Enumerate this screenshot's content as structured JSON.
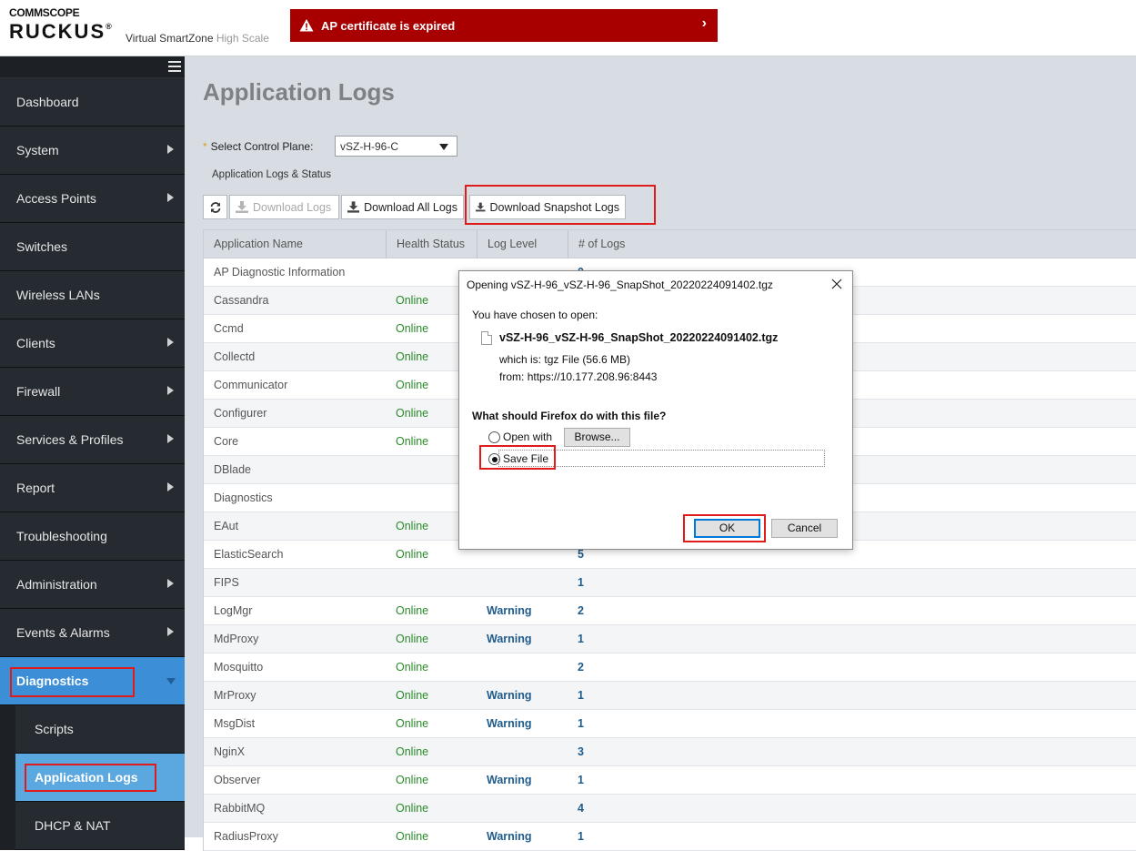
{
  "header": {
    "brand_top": "COMMSCOPE",
    "brand_main": "RUCKUS",
    "product_name": "Virtual SmartZone",
    "product_edition": "High Scale",
    "alert_text": "AP certificate is expired",
    "alert_color": "#a80000"
  },
  "sidebar": {
    "items": [
      {
        "label": "Dashboard",
        "has_arrow": false
      },
      {
        "label": "System",
        "has_arrow": true
      },
      {
        "label": "Access Points",
        "has_arrow": true
      },
      {
        "label": "Switches",
        "has_arrow": false
      },
      {
        "label": "Wireless LANs",
        "has_arrow": false
      },
      {
        "label": "Clients",
        "has_arrow": true
      },
      {
        "label": "Firewall",
        "has_arrow": true
      },
      {
        "label": "Services & Profiles",
        "has_arrow": true
      },
      {
        "label": "Report",
        "has_arrow": true
      },
      {
        "label": "Troubleshooting",
        "has_arrow": false
      },
      {
        "label": "Administration",
        "has_arrow": true
      },
      {
        "label": "Events & Alarms",
        "has_arrow": true
      },
      {
        "label": "Diagnostics",
        "active": true
      }
    ],
    "sub_items": [
      {
        "label": "Scripts",
        "active": false
      },
      {
        "label": "Application Logs",
        "active": true
      },
      {
        "label": "DHCP & NAT",
        "active": false
      }
    ]
  },
  "page": {
    "title": "Application Logs",
    "control_plane_label": "Select Control Plane:",
    "control_plane_value": "vSZ-H-96-C",
    "section_label": "Application Logs & Status"
  },
  "toolbar": {
    "download_logs": "Download Logs",
    "download_all_logs": "Download All Logs",
    "download_snapshot_logs": "Download Snapshot Logs"
  },
  "table": {
    "columns": [
      "Application Name",
      "Health Status",
      "Log Level",
      "# of Logs"
    ],
    "rows": [
      [
        "AP Diagnostic Information",
        "",
        "",
        "0"
      ],
      [
        "Cassandra",
        "Online",
        "",
        ""
      ],
      [
        "Ccmd",
        "Online",
        "",
        ""
      ],
      [
        "Collectd",
        "Online",
        "",
        ""
      ],
      [
        "Communicator",
        "Online",
        "",
        ""
      ],
      [
        "Configurer",
        "Online",
        "",
        ""
      ],
      [
        "Core",
        "Online",
        "",
        ""
      ],
      [
        "DBlade",
        "",
        "",
        ""
      ],
      [
        "Diagnostics",
        "",
        "",
        ""
      ],
      [
        "EAut",
        "Online",
        "",
        ""
      ],
      [
        "ElasticSearch",
        "Online",
        "",
        "5"
      ],
      [
        "FIPS",
        "",
        "",
        "1"
      ],
      [
        "LogMgr",
        "Online",
        "Warning",
        "2"
      ],
      [
        "MdProxy",
        "Online",
        "Warning",
        "1"
      ],
      [
        "Mosquitto",
        "Online",
        "",
        "2"
      ],
      [
        "MrProxy",
        "Online",
        "Warning",
        "1"
      ],
      [
        "MsgDist",
        "Online",
        "Warning",
        "1"
      ],
      [
        "NginX",
        "Online",
        "",
        "3"
      ],
      [
        "Observer",
        "Online",
        "Warning",
        "1"
      ],
      [
        "RabbitMQ",
        "Online",
        "",
        "4"
      ],
      [
        "RadiusProxy",
        "Online",
        "Warning",
        "1"
      ]
    ]
  },
  "dialog": {
    "title": "Opening vSZ-H-96_vSZ-H-96_SnapShot_20220224091402.tgz",
    "chosen_text": "You have chosen to open:",
    "filename": "vSZ-H-96_vSZ-H-96_SnapShot_20220224091402.tgz",
    "which_is_label": "which is:",
    "which_is_value": "tgz File (56.6 MB)",
    "from_label": "from:",
    "from_value": "https://10.177.208.96:8443",
    "question": "What should Firefox do with this file?",
    "open_with_label": "Open with",
    "browse_label": "Browse...",
    "save_file_label": "Save File",
    "selected_option": "save_file",
    "ok_label": "OK",
    "cancel_label": "Cancel"
  }
}
